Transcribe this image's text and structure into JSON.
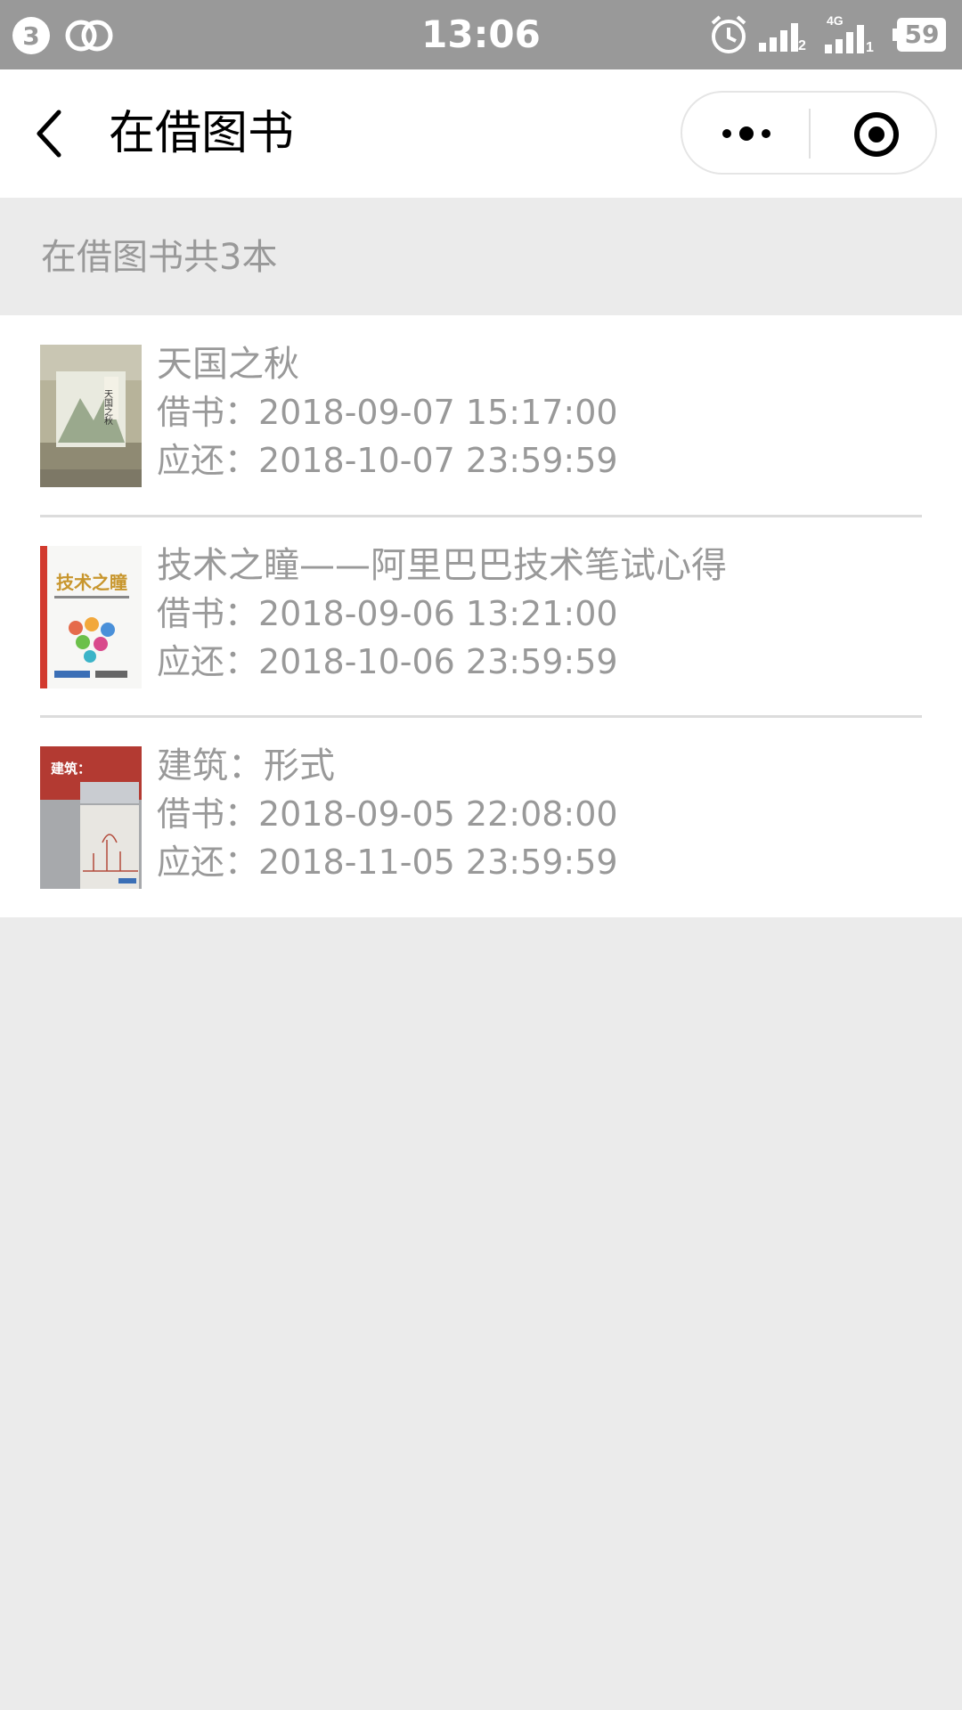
{
  "status_bar": {
    "notification_count": "3",
    "time": "13:06",
    "signal_label": "4G",
    "sim1_label": "2",
    "sim2_label": "1",
    "battery": "59"
  },
  "nav": {
    "title": "在借图书"
  },
  "summary": {
    "text": "在借图书共3本"
  },
  "books": [
    {
      "title": "天国之秋",
      "borrowed": "借书：2018-09-07 15:17:00",
      "due": "应还：2018-10-07 23:59:59"
    },
    {
      "title": "技术之瞳——阿里巴巴技术笔试心得",
      "borrowed": "借书：2018-09-06 13:21:00",
      "due": "应还：2018-10-06 23:59:59"
    },
    {
      "title": "建筑：形式",
      "borrowed": "借书：2018-09-05 22:08:00",
      "due": "应还：2018-11-05 23:59:59"
    }
  ],
  "cover_marks": {
    "cover1": "天国之秋",
    "cover2": "技术之瞳",
    "cover3": "建筑："
  }
}
